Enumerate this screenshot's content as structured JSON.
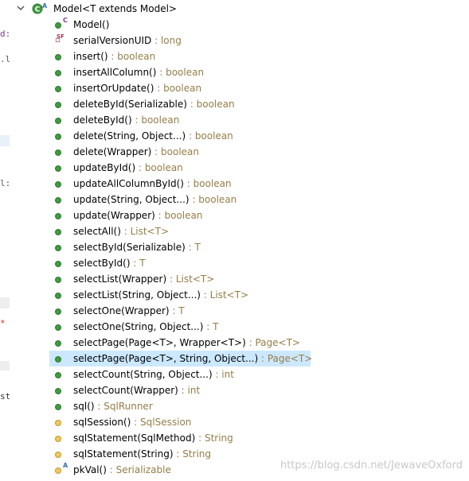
{
  "gutter": [
    {
      "text": "d:",
      "kind": "code"
    },
    {
      "text": ".l'",
      "kind": "code"
    },
    {
      "text": "l:",
      "kind": "code"
    },
    {
      "text": "*",
      "kind": "marker"
    },
    {
      "text": "st",
      "kind": "code"
    }
  ],
  "header": {
    "label": "Model<T extends Model>",
    "expand_icon": "chevron-down-icon",
    "class_icon": "class-icon",
    "icon_overlay": "A"
  },
  "members": [
    {
      "name": "Model()",
      "type": "",
      "visibility": "public",
      "overlay": "C"
    },
    {
      "name": "serialVersionUID",
      "type": "long",
      "visibility": "field",
      "overlay": "SF"
    },
    {
      "name": "insert()",
      "type": "boolean",
      "visibility": "public"
    },
    {
      "name": "insertAllColumn()",
      "type": "boolean",
      "visibility": "public"
    },
    {
      "name": "insertOrUpdate()",
      "type": "boolean",
      "visibility": "public"
    },
    {
      "name": "deleteById(Serializable)",
      "type": "boolean",
      "visibility": "public"
    },
    {
      "name": "deleteById()",
      "type": "boolean",
      "visibility": "public"
    },
    {
      "name": "delete(String, Object...)",
      "type": "boolean",
      "visibility": "public"
    },
    {
      "name": "delete(Wrapper)",
      "type": "boolean",
      "visibility": "public"
    },
    {
      "name": "updateById()",
      "type": "boolean",
      "visibility": "public"
    },
    {
      "name": "updateAllColumnById()",
      "type": "boolean",
      "visibility": "public"
    },
    {
      "name": "update(String, Object...)",
      "type": "boolean",
      "visibility": "public"
    },
    {
      "name": "update(Wrapper)",
      "type": "boolean",
      "visibility": "public"
    },
    {
      "name": "selectAll()",
      "type": "List<T>",
      "visibility": "public"
    },
    {
      "name": "selectById(Serializable)",
      "type": "T",
      "visibility": "public"
    },
    {
      "name": "selectById()",
      "type": "T",
      "visibility": "public"
    },
    {
      "name": "selectList(Wrapper)",
      "type": "List<T>",
      "visibility": "public"
    },
    {
      "name": "selectList(String, Object...)",
      "type": "List<T>",
      "visibility": "public"
    },
    {
      "name": "selectOne(Wrapper)",
      "type": "T",
      "visibility": "public"
    },
    {
      "name": "selectOne(String, Object...)",
      "type": "T",
      "visibility": "public"
    },
    {
      "name": "selectPage(Page<T>, Wrapper<T>)",
      "type": "Page<T>",
      "visibility": "public"
    },
    {
      "name": "selectPage(Page<T>, String, Object...)",
      "type": "Page<T>",
      "visibility": "public",
      "selected": true
    },
    {
      "name": "selectCount(String, Object...)",
      "type": "int",
      "visibility": "public"
    },
    {
      "name": "selectCount(Wrapper)",
      "type": "int",
      "visibility": "public"
    },
    {
      "name": "sql()",
      "type": "SqlRunner",
      "visibility": "public"
    },
    {
      "name": "sqlSession()",
      "type": "SqlSession",
      "visibility": "protected"
    },
    {
      "name": "sqlStatement(SqlMethod)",
      "type": "String",
      "visibility": "protected"
    },
    {
      "name": "sqlStatement(String)",
      "type": "String",
      "visibility": "protected"
    },
    {
      "name": "pkVal()",
      "type": "Serializable",
      "visibility": "protected",
      "overlay": "A"
    }
  ],
  "separator": " : ",
  "watermark": "https://blog.csdn.net/JewaveOxford",
  "colors": {
    "selection": "#cce8ff",
    "type_text": "#957d47",
    "public_dot": "#3f9b3f",
    "protected_dot": "#f2c75c"
  }
}
